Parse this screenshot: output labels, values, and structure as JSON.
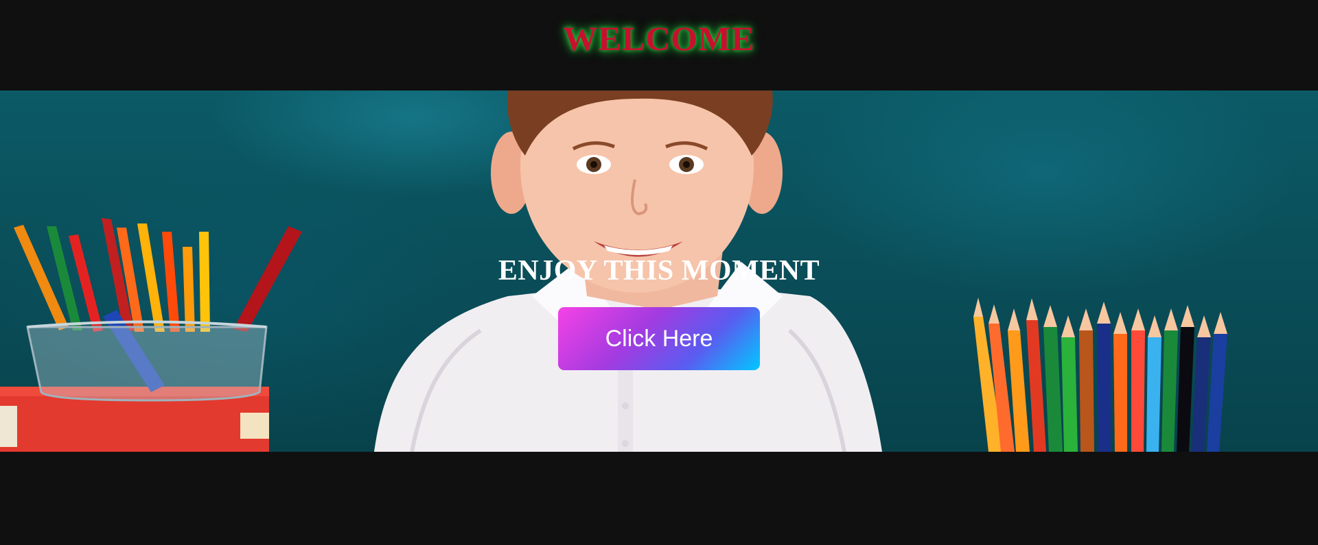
{
  "header": {
    "title": "WELCOME",
    "title_color": "#c8102e",
    "glow_color": "#1fbf3a"
  },
  "hero": {
    "background_color": "#0a4f5a",
    "image_description_icon": "child-with-pencils-photo",
    "heading": "ENJOY THIS MOMENT",
    "button_label": "Click Here",
    "button_gradient": [
      "#f542e6",
      "#a23be0",
      "#00c8ff"
    ]
  },
  "page": {
    "background_color": "#101010"
  }
}
